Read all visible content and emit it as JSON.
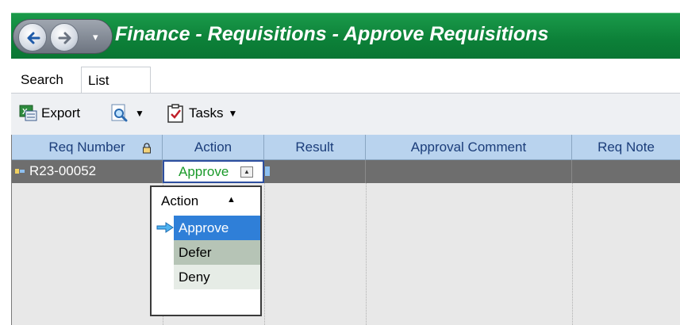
{
  "window": {
    "title": "Finance - Requisitions - Approve Requisitions"
  },
  "tabs": [
    {
      "label": "Search"
    },
    {
      "label": "List"
    }
  ],
  "toolbar": {
    "export_label": "Export",
    "tasks_label": "Tasks"
  },
  "grid": {
    "columns": [
      {
        "label": "Req Number"
      },
      {
        "label": "Action"
      },
      {
        "label": "Result"
      },
      {
        "label": "Approval Comment"
      },
      {
        "label": "Req Note"
      }
    ],
    "rows": [
      {
        "req_number": "R23-00052",
        "action": "Approve",
        "result": "",
        "approval_comment": "",
        "req_note": ""
      }
    ]
  },
  "dropdown": {
    "header": "Action",
    "options": [
      {
        "label": "Approve"
      },
      {
        "label": "Defer"
      },
      {
        "label": "Deny"
      }
    ]
  },
  "colors": {
    "titlebar": "#0c8038",
    "header": "#b9d3ee",
    "selected_option": "#2f7fd8",
    "action_text": "#1a9a2a"
  }
}
